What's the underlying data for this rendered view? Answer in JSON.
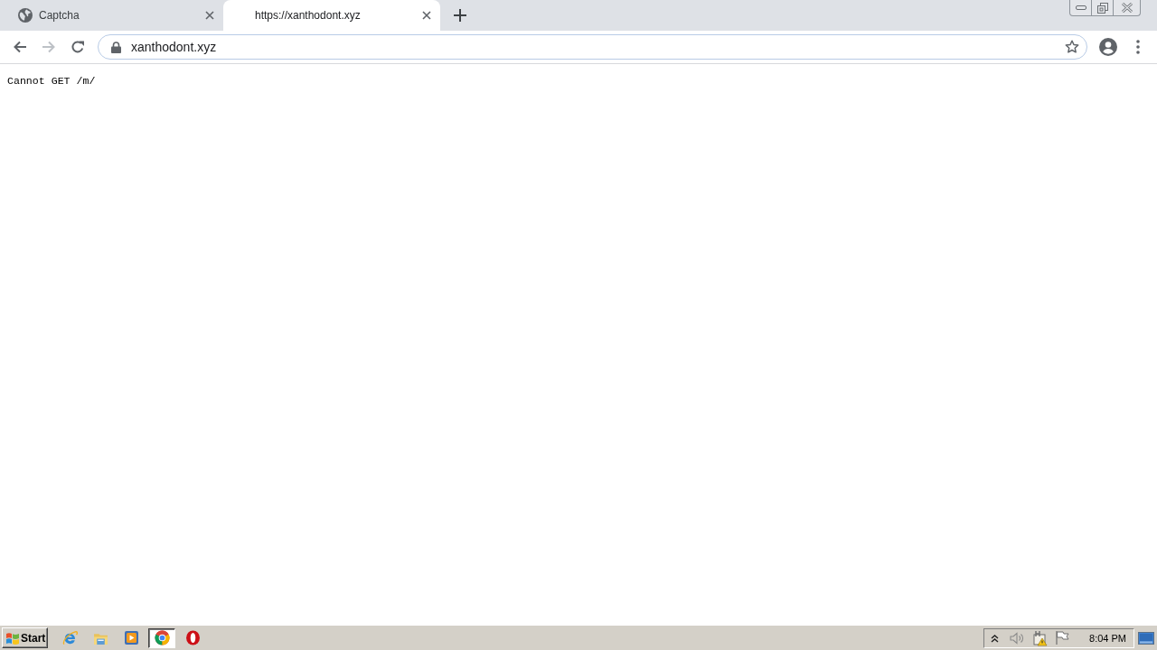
{
  "browser": {
    "tabs": [
      {
        "title": "Captcha",
        "favicon": true,
        "selected": false
      },
      {
        "title": "https://xanthodont.xyz",
        "favicon": false,
        "selected": true
      }
    ],
    "address_bar": {
      "value": "xanthodont.xyz"
    }
  },
  "page": {
    "text": "Cannot GET /m/"
  },
  "taskbar": {
    "start": "Start",
    "apps": [
      {
        "kind": "ie",
        "selected": false
      },
      {
        "kind": "explorer",
        "selected": false
      },
      {
        "kind": "media",
        "selected": false
      },
      {
        "kind": "chrome",
        "selected": true
      },
      {
        "kind": "opera",
        "selected": false
      }
    ],
    "clock": "8:04 PM"
  }
}
